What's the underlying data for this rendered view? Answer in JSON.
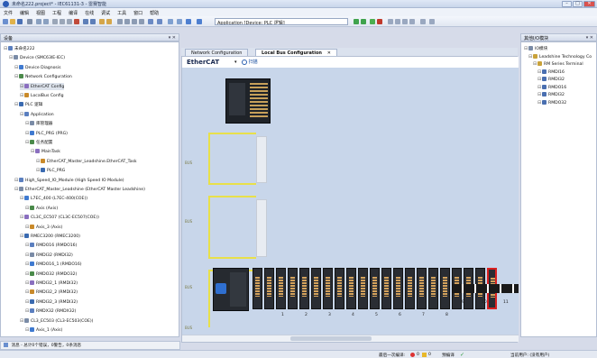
{
  "window": {
    "title": "未命名222.project* - IEC61131-3 - 雷赛智能"
  },
  "menu": [
    "文件",
    "编辑",
    "视图",
    "工程",
    "编译",
    "在线",
    "调试",
    "工具",
    "窗口",
    "帮助"
  ],
  "toolbar": {
    "combo_text": "Application [Device: PLC 逻辑]"
  },
  "device_panel": {
    "title": "设备",
    "rows": [
      {
        "label": "未命名222",
        "indent": 0
      },
      {
        "label": "Device (SMC63IE-IEC)",
        "indent": 1
      },
      {
        "label": "Device Diagnosis",
        "indent": 2
      },
      {
        "label": "Network Configuration",
        "indent": 2
      },
      {
        "label": "EtherCAT Config",
        "indent": 3
      },
      {
        "label": "LocalBus Config",
        "indent": 3
      },
      {
        "label": "PLC 逻辑",
        "indent": 2
      },
      {
        "label": "Application",
        "indent": 3
      },
      {
        "label": "库管理器",
        "indent": 4
      },
      {
        "label": "PLC_PRG (PRG)",
        "indent": 4
      },
      {
        "label": "任务配置",
        "indent": 4
      },
      {
        "label": "MainTask",
        "indent": 5
      },
      {
        "label": "EtherCAT_Master_Leadshine.EtherCAT_Task",
        "indent": 6
      },
      {
        "label": "PLC_PRG",
        "indent": 6
      },
      {
        "label": "High_Speed_IO_Module (High Speed IO Module)",
        "indent": 2
      },
      {
        "label": "EtherCAT_Master_Leadshine (EtherCAT Master Leadshine)",
        "indent": 2
      },
      {
        "label": "L7EC_400 (L7EC-400(COE))",
        "indent": 3
      },
      {
        "label": "Axis (Axis)",
        "indent": 4
      },
      {
        "label": "CL3C_EC507 (CL3C-EC507(COE))",
        "indent": 3
      },
      {
        "label": "Axis_3 (Axis)",
        "indent": 4
      },
      {
        "label": "RMEC3200 (RMEC3200)",
        "indent": 3
      },
      {
        "label": "RMDO16 (RMDO16)",
        "indent": 4
      },
      {
        "label": "RMDI32 (RMDI32)",
        "indent": 4
      },
      {
        "label": "RMDO16_1 (RMDO16)",
        "indent": 4
      },
      {
        "label": "RMDO32 (RMDO32)",
        "indent": 4
      },
      {
        "label": "RMDI32_1 (RMDI32)",
        "indent": 4
      },
      {
        "label": "RMDI32_2 (RMDI32)",
        "indent": 4
      },
      {
        "label": "RMDI32_3 (RMDI32)",
        "indent": 4
      },
      {
        "label": "RMDX32 (RMDX32)",
        "indent": 4
      },
      {
        "label": "CL3_EC503 (CL3-EC503(COE))",
        "indent": 3
      },
      {
        "label": "Axis_1 (Axis)",
        "indent": 4
      }
    ]
  },
  "tabs": [
    {
      "label": "Network Configuration"
    },
    {
      "label": "Local Bus Configuration"
    }
  ],
  "editor": {
    "bus_label": "EtherCAT",
    "scan_label": "扫描",
    "bus_tags": [
      "BUS",
      "BUS",
      "BUS",
      "BUS"
    ],
    "slot_numbers": [
      "1",
      "2",
      "3",
      "4",
      "5",
      "6",
      "7",
      "8",
      "9",
      "10",
      "11"
    ]
  },
  "right_panel": {
    "title": "其他I/O模块",
    "rows": [
      {
        "label": "IO模块",
        "indent": 0
      },
      {
        "label": "Leadshine Technology Co",
        "indent": 1
      },
      {
        "label": "RM Series Terminal",
        "indent": 2
      },
      {
        "label": "RMDI16",
        "indent": 3
      },
      {
        "label": "RMDI32",
        "indent": 3
      },
      {
        "label": "RMDO16",
        "indent": 3
      },
      {
        "label": "RMDI32",
        "indent": 3
      },
      {
        "label": "RMDO32",
        "indent": 3
      }
    ]
  },
  "messages": {
    "text": "消息 - 总计0个错误，0警告，0条消息"
  },
  "status": {
    "last_build": "最后一次编译:",
    "errors": "0",
    "warnings": "0",
    "precompile": "预编译",
    "current_user": "当前用户: (没有用户)"
  }
}
